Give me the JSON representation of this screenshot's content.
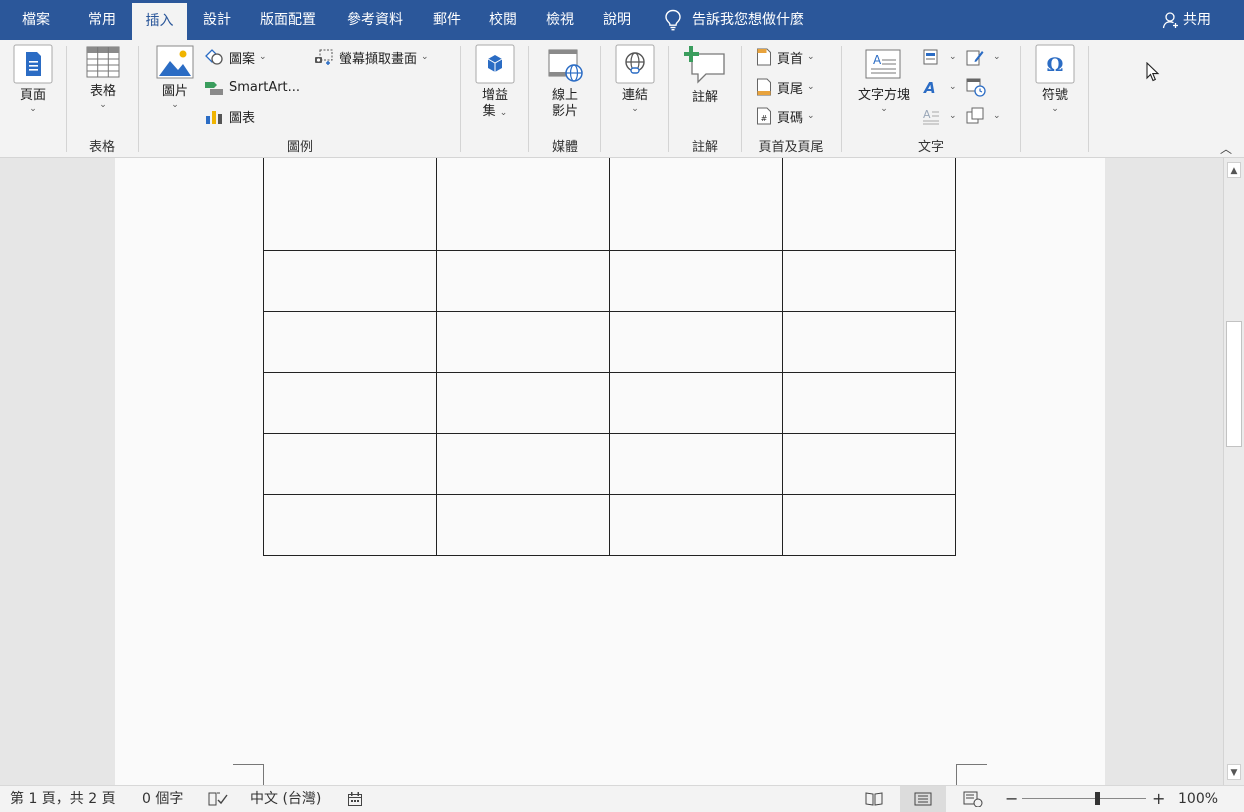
{
  "tabs": [
    {
      "label": "檔案",
      "active": false
    },
    {
      "label": "常用",
      "active": false
    },
    {
      "label": "插入",
      "active": true
    },
    {
      "label": "設計",
      "active": false
    },
    {
      "label": "版面配置",
      "active": false
    },
    {
      "label": "參考資料",
      "active": false
    },
    {
      "label": "郵件",
      "active": false
    },
    {
      "label": "校閱",
      "active": false
    },
    {
      "label": "檢視",
      "active": false
    },
    {
      "label": "說明",
      "active": false
    }
  ],
  "tell_me": "告訴我您想做什麼",
  "share": "共用",
  "ribbon": {
    "pages": {
      "button": "頁面"
    },
    "tables": {
      "button": "表格",
      "group": "表格"
    },
    "illustrations": {
      "picture": "圖片",
      "shapes": "圖案",
      "smartart": "SmartArt...",
      "chart": "圖表",
      "screenshot": "螢幕擷取畫面",
      "group": "圖例"
    },
    "addins": {
      "line1": "增益",
      "line2": "集"
    },
    "media": {
      "line1": "線上",
      "line2": "影片",
      "group": "媒體"
    },
    "links": {
      "button": "連結"
    },
    "comments": {
      "button": "註解",
      "group": "註解"
    },
    "header_footer": {
      "header": "頁首",
      "footer": "頁尾",
      "page_number": "頁碼",
      "group": "頁首及頁尾"
    },
    "text": {
      "textbox": "文字方塊",
      "group": "文字"
    },
    "symbols": {
      "button": "符號"
    }
  },
  "colors": {
    "accent": "#2b579a",
    "ribbon_bg": "#f3f3f3"
  },
  "table": {
    "rows": 6,
    "cols": 4
  },
  "status": {
    "page": "第 1 頁，共 2 頁",
    "words": "0 個字",
    "language": "中文 (台灣)",
    "zoom": "100%",
    "zoom_level": 100
  }
}
